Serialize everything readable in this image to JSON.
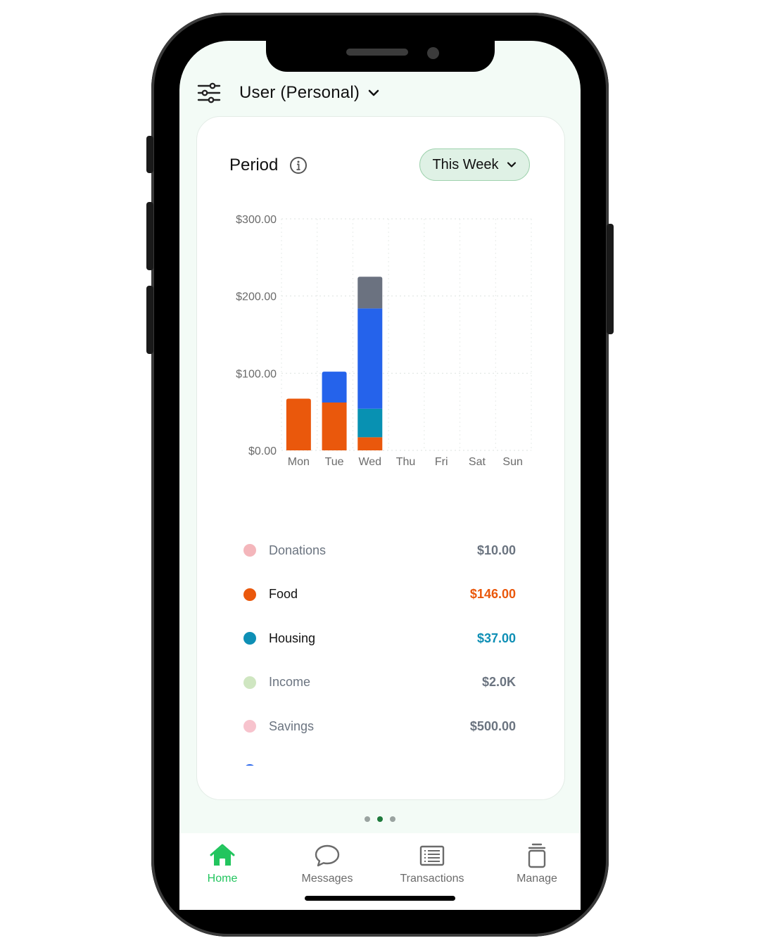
{
  "header": {
    "title": "User (Personal)"
  },
  "period": {
    "label": "Period",
    "selector_label": "This Week"
  },
  "chart_data": {
    "type": "bar",
    "stacked": true,
    "categories": [
      "Mon",
      "Tue",
      "Wed",
      "Thu",
      "Fri",
      "Sat",
      "Sun"
    ],
    "yticks": [
      "$300.00",
      "$200.00",
      "$100.00",
      "$0.00"
    ],
    "ylim": [
      0,
      300
    ],
    "grid": true,
    "series": [
      {
        "name": "Food",
        "color": "#ea580c",
        "values": [
          67,
          62,
          17,
          0,
          0,
          0,
          0
        ]
      },
      {
        "name": "Housing",
        "color": "#0891b2",
        "values": [
          0,
          0,
          37,
          0,
          0,
          0,
          0
        ]
      },
      {
        "name": "",
        "color": "#2563eb",
        "values": [
          0,
          40,
          130,
          0,
          0,
          0,
          0
        ]
      },
      {
        "name": "",
        "color": "#6b7280",
        "values": [
          0,
          0,
          41,
          0,
          0,
          0,
          0
        ]
      }
    ]
  },
  "legend": [
    {
      "name": "Donations",
      "value": "$10.00",
      "dot_color": "#f4b6bb",
      "name_color": "#6b7480",
      "value_color": "#6b7480"
    },
    {
      "name": "Food",
      "value": "$146.00",
      "dot_color": "#ea580c",
      "name_color": "#111111",
      "value_color": "#ea580c"
    },
    {
      "name": "Housing",
      "value": "$37.00",
      "dot_color": "#0e8fb5",
      "name_color": "#111111",
      "value_color": "#0e8fb5"
    },
    {
      "name": "Income",
      "value": "$2.0K",
      "dot_color": "#cfe6c1",
      "name_color": "#6b7480",
      "value_color": "#6b7480"
    },
    {
      "name": "Savings",
      "value": "$500.00",
      "dot_color": "#f7c3cd",
      "name_color": "#6b7480",
      "value_color": "#6b7480"
    },
    {
      "name": "",
      "value": "",
      "dot_color": "#2563eb",
      "name_color": "#111111",
      "value_color": "#6b7480"
    }
  ],
  "tabs": [
    {
      "label": "Home",
      "icon": "home-icon",
      "active": true
    },
    {
      "label": "Messages",
      "icon": "chat-bubble-icon",
      "active": false
    },
    {
      "label": "Transactions",
      "icon": "list-icon",
      "active": false
    },
    {
      "label": "Manage",
      "icon": "trash-can-icon",
      "active": false
    }
  ],
  "colors": {
    "accent": "#22c55e",
    "pager_active": "#1e7a3c"
  }
}
